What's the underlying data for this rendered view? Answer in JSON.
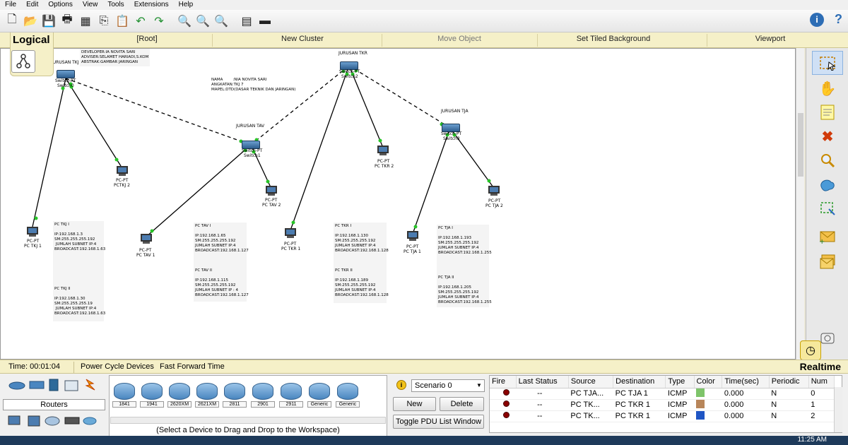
{
  "menu": [
    "File",
    "Edit",
    "Options",
    "View",
    "Tools",
    "Extensions",
    "Help"
  ],
  "toolbar": {
    "icons": [
      "new-icon",
      "open-icon",
      "save-icon",
      "print-icon",
      "activity-wizard-icon",
      "copy-icon",
      "paste-icon",
      "undo-icon",
      "redo-icon",
      "zoom-in-icon",
      "zoom-reset-icon",
      "zoom-out-icon",
      "palette-icon",
      "custom-device-icon"
    ],
    "info": "i",
    "help": "?"
  },
  "navbar": {
    "logical": "Logical",
    "root": "[Root]",
    "new_cluster": "New Cluster",
    "move_object": "Move Object",
    "set_tiled_background": "Set Tiled Background",
    "viewport": "Viewport"
  },
  "workspace": {
    "header_note": {
      "line1": "DEVELOPER:IA NOVITA SARI",
      "line2": "ADVISER:SELAMET HARIADI,S.KOM",
      "line3": "ABSTRAK:GAMBAR JARINGAN"
    },
    "name_note": {
      "line1": "NAMA        :NIA NOVITA SARI",
      "line2": "ANGKATAN:TKJ 7",
      "line3": "MAPEL:DTD(DASAR TEKNIK DAN JARINGAN)"
    },
    "groups": {
      "tkj": "JURUSAN TKJ",
      "tav": "JURUSAN TAV",
      "tkr": "JURUSAN TKR",
      "tja": "JURUSAN TJA"
    },
    "switches": {
      "tkj": {
        "model": "Switch-PT",
        "name": "Switch0"
      },
      "tav": {
        "model": "Switch-PT",
        "name": "Switch1"
      },
      "tkr": {
        "model": "Switch-PT",
        "name": "Switch2"
      },
      "tja": {
        "model": "Switch-PT",
        "name": "Switch3"
      }
    },
    "pcs": {
      "tkj1": {
        "model": "PC-PT",
        "name": "PC TKJ 1"
      },
      "tkj2": {
        "model": "PC-PT",
        "name": "PCTKJ 2"
      },
      "tav1": {
        "model": "PC-PT",
        "name": "PC TAV 1"
      },
      "tav2": {
        "model": "PC-PT",
        "name": "PC TAV 2"
      },
      "tkr1": {
        "model": "PC-PT",
        "name": "PC TKR 1"
      },
      "tkr2": {
        "model": "PC-PT",
        "name": "PC TKR 2"
      },
      "tja1": {
        "model": "PC-PT",
        "name": "PC TJA 1"
      },
      "tja2": {
        "model": "PC-PT",
        "name": "PC TJA 2"
      }
    },
    "notes": {
      "tkj": "PC TKJ I\n\nIP:192.168.1.3\nSM:255.255.255.192\n JUMLAH SUBNET IP:4\nBROADCAST:192.168.1.63\n\n\n\n\n\n\n\nPC TKJ II\n\nIP:192.168.1.30\nSM:255.255.255.19\n JUMLAH SUBNET IP:4\nBROADCAST:192.168.1.63",
      "tav": "PC TAV I\n\nIP:192.168.1.65\nSM:255.255.255.192\nJUMLAH SUBNET IP:4\nBROADCAST:192.168.1.127\n\n\n\nPC TAV II\n\nIP:192.168.1.115\nSM:255.255.255.192\nJUMLAH SUBNET IP : 4\nBROADCAST:192.168.1.127",
      "tkr": "PC TKR I\n\nIP:192.168.1.130\nSM:255.255.255.192\nJUMLAH SUBNET IP:4\nBROADCAST:192.168.1.128\n\n\n\nPC TKR II\n\nIP:192.168.1.189\nSM:255.255.255.192\nJUMLAH SUBNET IP:4\nBROADCAST:192.168.1.128",
      "tja": "PC TJA I\n\nIP:192.168.1.193\nSM:255.255.255.192\nJUMLAH SUBNET IP:4\nBROADCAST:192.168.1.255\n\n\n\n\nPC TJA II\n\nIP:192.168.1.205\nSM:255.255.255.192\nJUMLAH SUBNET IP:4\nBROADCAST:192.168.1.255"
    }
  },
  "status": {
    "time": "Time: 00:01:04",
    "power_cycle": "Power Cycle Devices",
    "fast_forward": "Fast Forward Time",
    "realtime": "Realtime"
  },
  "device_panel": {
    "category": "Routers",
    "devices": [
      "1841",
      "1941",
      "2620XM",
      "2621XM",
      "2811",
      "2901",
      "2911",
      "Generic",
      "Generic"
    ],
    "hint": "(Select a Device to Drag and Drop to the Workspace)"
  },
  "scenario": {
    "selected": "Scenario 0",
    "new": "New",
    "delete": "Delete",
    "toggle": "Toggle PDU List Window"
  },
  "pdu": {
    "columns": [
      "Fire",
      "Last Status",
      "Source",
      "Destination",
      "Type",
      "Color",
      "Time(sec)",
      "Periodic",
      "Num"
    ],
    "rows": [
      {
        "last_status": "--",
        "source": "PC TJA...",
        "destination": "PC TJA 1",
        "type": "ICMP",
        "color": "#7ec46a",
        "time": "0.000",
        "periodic": "N",
        "num": "0"
      },
      {
        "last_status": "--",
        "source": "PC TK...",
        "destination": "PC TKR 1",
        "type": "ICMP",
        "color": "#b8865a",
        "time": "0.000",
        "periodic": "N",
        "num": "1"
      },
      {
        "last_status": "--",
        "source": "PC TK...",
        "destination": "PC TKR 1",
        "type": "ICMP",
        "color": "#1f55c4",
        "time": "0.000",
        "periodic": "N",
        "num": "2"
      }
    ]
  },
  "taskbar": {
    "clock": "11:25 AM"
  }
}
